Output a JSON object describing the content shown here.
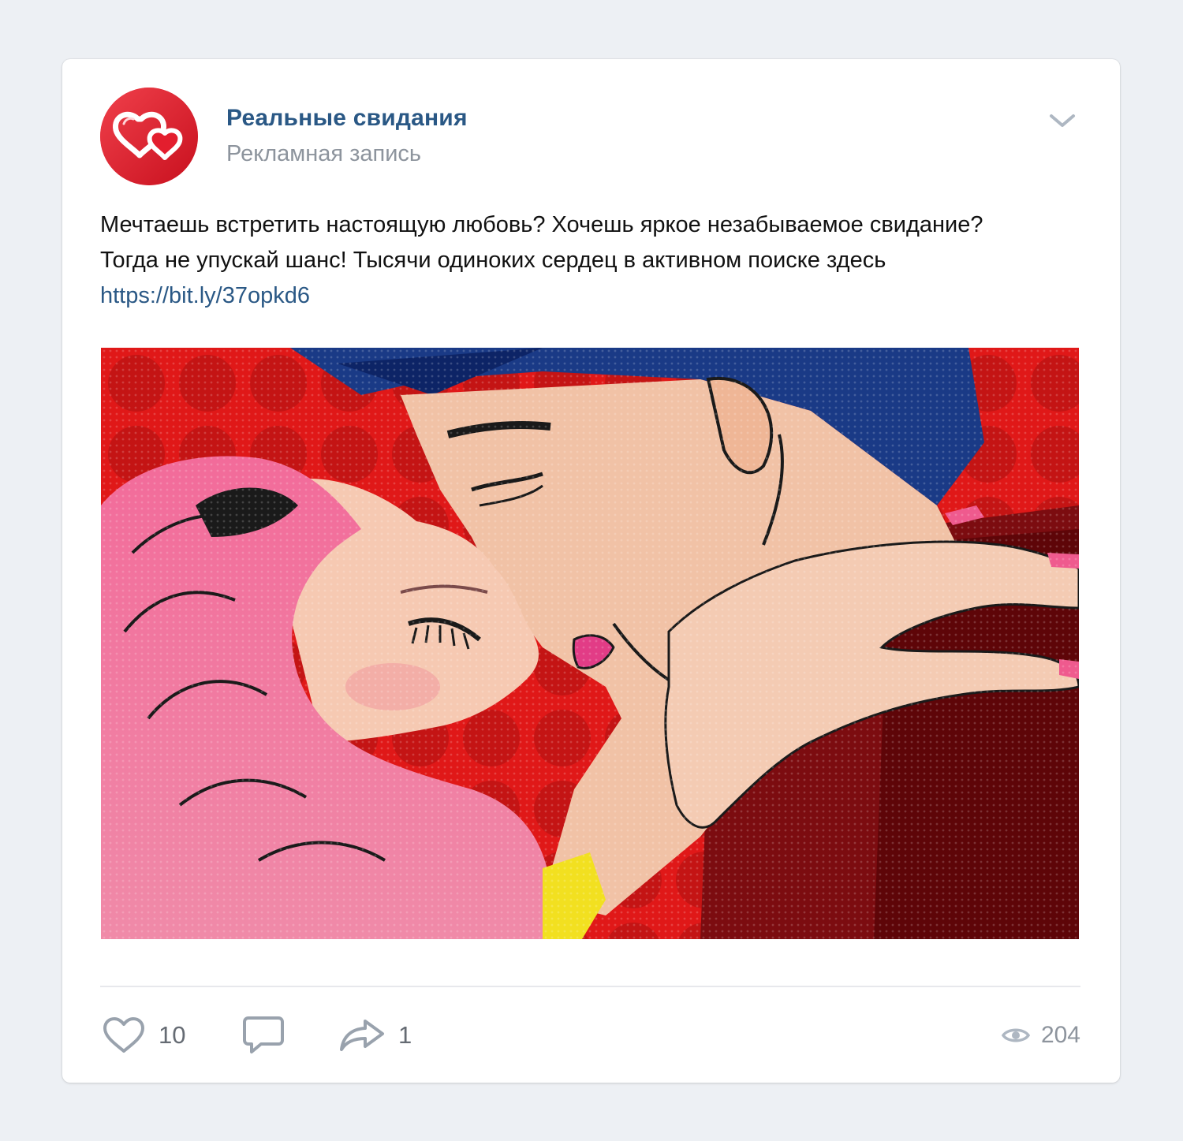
{
  "post": {
    "author_name": "Реальные свидания",
    "subtitle": "Рекламная запись",
    "text_before_link": "Мечтаешь встретить настоящую любовь? Хочешь яркое незабываемое свидание? Тогда не упускай шанс! Тысячи одиноких сердец в активном поиске здесь ",
    "link_text": "https://bit.ly/37opkd6",
    "avatar_icon": "double-heart-icon",
    "image_description_icon": "pop-art-kiss-image"
  },
  "actions": {
    "likes_count": "10",
    "comments_count": "",
    "shares_count": "1",
    "views_count": "204"
  },
  "colors": {
    "link": "#2a5885",
    "avatar_bg": "#e31e2e",
    "muted": "#8d949d",
    "page_bg": "#edf0f4"
  }
}
